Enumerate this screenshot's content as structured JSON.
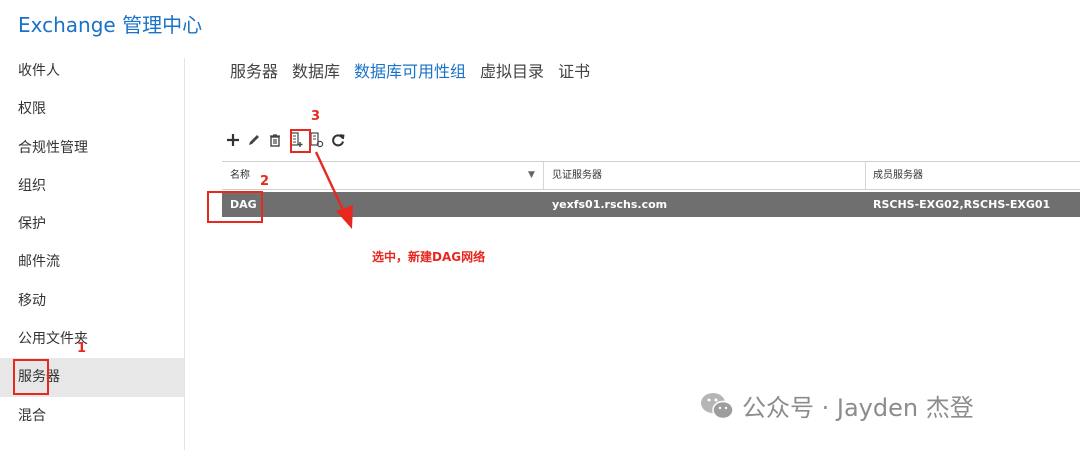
{
  "header": {
    "title": "Exchange 管理中心"
  },
  "sidebar": {
    "items": [
      {
        "label": "收件人"
      },
      {
        "label": "权限"
      },
      {
        "label": "合规性管理"
      },
      {
        "label": "组织"
      },
      {
        "label": "保护"
      },
      {
        "label": "邮件流"
      },
      {
        "label": "移动"
      },
      {
        "label": "公用文件夹"
      },
      {
        "label": "服务器",
        "active": true
      },
      {
        "label": "混合"
      }
    ]
  },
  "tabs": [
    {
      "label": "服务器"
    },
    {
      "label": "数据库"
    },
    {
      "label": "数据库可用性组",
      "active": true
    },
    {
      "label": "虚拟目录"
    },
    {
      "label": "证书"
    }
  ],
  "toolbar": {
    "buttons": [
      "add-icon",
      "edit-icon",
      "delete-icon",
      "new-dag-network-icon",
      "manage-dag-membership-icon",
      "refresh-icon"
    ]
  },
  "grid": {
    "columns": [
      "名称",
      "见证服务器",
      "成员服务器"
    ],
    "rows": [
      {
        "name": "DAG",
        "witness": "yexfs01.rschs.com",
        "members": "RSCHS-EXG02,RSCHS-EXG01"
      }
    ]
  },
  "annotations": {
    "step1": "1",
    "step2": "2",
    "step3": "3",
    "note": "选中，新建DAG网络"
  },
  "watermark": {
    "text": "公众号 · Jayden 杰登"
  },
  "colors": {
    "accent": "#1a73c8",
    "annotation": "#e8281e",
    "selected_row": "#6f6f6f"
  }
}
